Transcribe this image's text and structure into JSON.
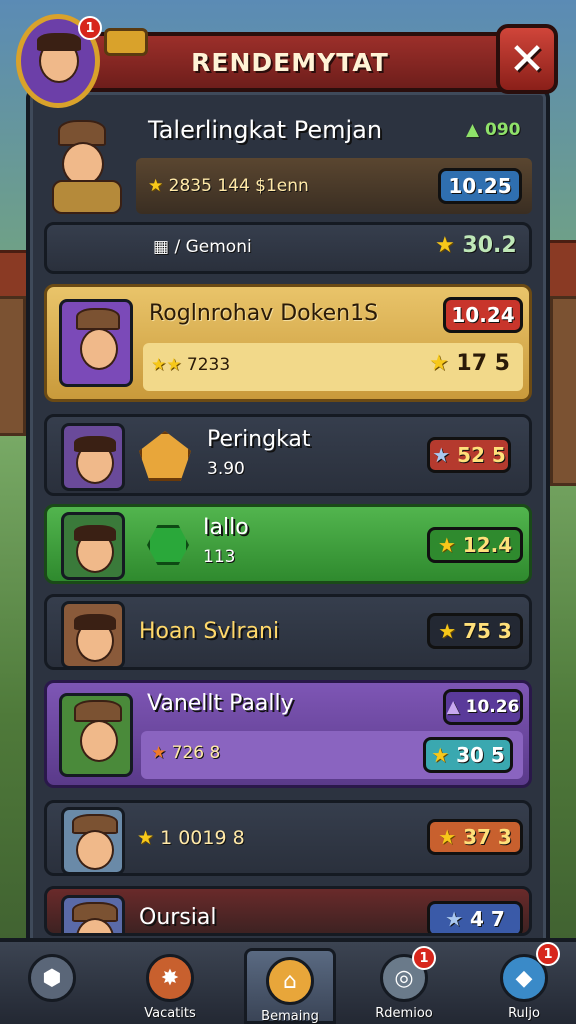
{
  "header": {
    "title": "RENDEMYTAT",
    "close_icon": "✕"
  },
  "top_badge": "1",
  "featured": {
    "name": "Talerlingkat Pemjan",
    "gain": "090",
    "stats": "2835 144 $1enn",
    "pill": "10.25",
    "gem_label": "/ Gemoni",
    "gem_value": "30.2"
  },
  "rows": [
    {
      "name": "Roglnrohav Doken1S",
      "sub": "7233",
      "pill": "10.24",
      "value": "17 5"
    },
    {
      "name": "Peringkat",
      "sub": "3.90",
      "value": "52 5"
    },
    {
      "name": "Iallo",
      "sub": "113",
      "value": "12.4"
    },
    {
      "name": "Hoan Svlrani",
      "value": "75 3"
    },
    {
      "name": "Vanellt Paally",
      "sub": "726 8",
      "pill": "10.26",
      "value": "30 5"
    },
    {
      "name": "",
      "sub": "1 0019 8",
      "value": "37 3"
    },
    {
      "name": "Oursial",
      "value": "4 7"
    }
  ],
  "nav": [
    {
      "label": "",
      "icon": "home-icon"
    },
    {
      "label": "Vacatits",
      "icon": "flame-icon"
    },
    {
      "label": "Bemaing",
      "icon": "house-icon"
    },
    {
      "label": "Rdemioo",
      "icon": "target-icon",
      "badge": "1"
    },
    {
      "label": "Ruljo",
      "icon": "shield-icon",
      "badge": "1"
    }
  ],
  "colors": {
    "gold": "#f7c81a",
    "red": "#d7261c",
    "green": "#52b54e",
    "purple": "#7e56b5"
  }
}
